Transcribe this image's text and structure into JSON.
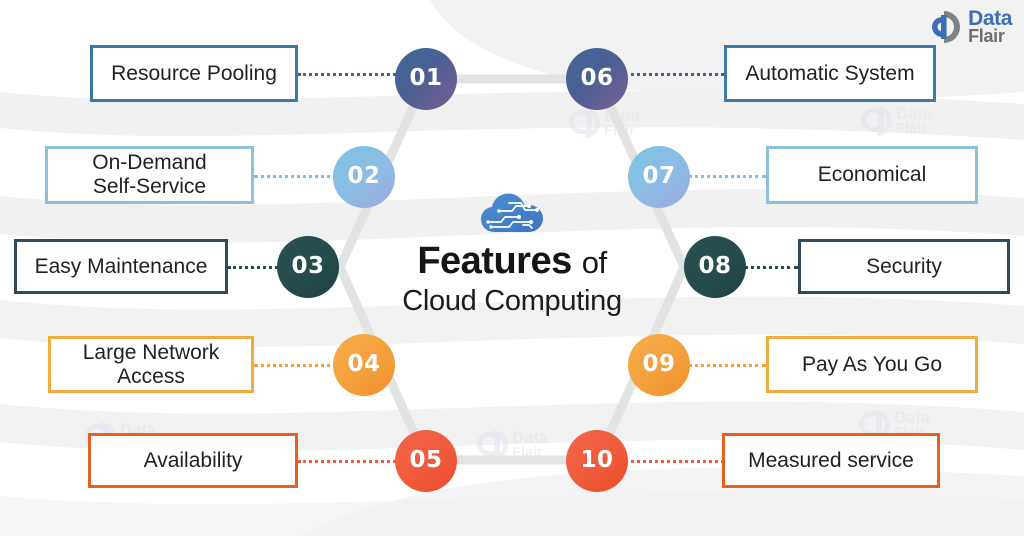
{
  "brand": {
    "name_primary": "Data",
    "name_secondary": "Flair",
    "mark_icon": "dataflair-logo-icon"
  },
  "watermark": {
    "name_primary": "Data",
    "name_secondary": "Flair"
  },
  "center": {
    "cloud_icon": "cloud-circuit-icon",
    "title_bold": "Features",
    "title_light": "of",
    "subtitle": "Cloud Computing"
  },
  "colors": {
    "node_01": "#43628f",
    "node_02": "#84bde0",
    "node_03": "#234b4a",
    "node_04": "#f3a03c",
    "node_05": "#f05a3c",
    "node_06": "#43628f",
    "node_07": "#84bde0",
    "node_08": "#234b4a",
    "node_09": "#f3a03c",
    "node_10": "#f05a3c",
    "box_01": "#3d7ba5",
    "box_02": "#8cc0dd",
    "box_03": "#31495a",
    "box_04": "#f0ac3e",
    "box_05": "#e8601f",
    "hexagon": "#e3e3e3",
    "brand_blue": "#3d6fb4",
    "brand_gray": "#6d6e71"
  },
  "items_left": [
    {
      "number": "01",
      "label": "Resource Pooling"
    },
    {
      "number": "02",
      "label": "On-Demand\nSelf-Service"
    },
    {
      "number": "03",
      "label": "Easy Maintenance"
    },
    {
      "number": "04",
      "label": "Large Network\nAccess"
    },
    {
      "number": "05",
      "label": "Availability"
    }
  ],
  "items_right": [
    {
      "number": "06",
      "label": "Automatic System"
    },
    {
      "number": "07",
      "label": "Economical"
    },
    {
      "number": "08",
      "label": "Security"
    },
    {
      "number": "09",
      "label": "Pay As You Go"
    },
    {
      "number": "10",
      "label": "Measured service"
    }
  ]
}
